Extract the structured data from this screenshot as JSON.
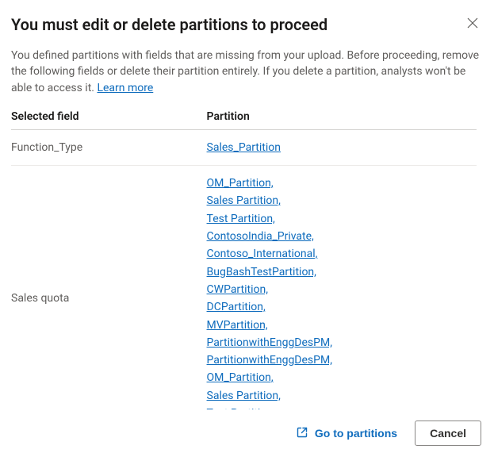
{
  "header": {
    "title": "You must edit or delete partitions to proceed"
  },
  "description": {
    "text": "You defined partitions with fields that are missing from your upload. Before proceeding, remove the following fields or delete their partition entirely. If you delete a partition, analysts won't be able to access it. ",
    "learn_more": "Learn more"
  },
  "table": {
    "col_field": "Selected field",
    "col_partition": "Partition",
    "rows": [
      {
        "field": "Function_Type",
        "partitions": [
          "Sales_Partition"
        ]
      },
      {
        "field": "Sales quota",
        "partitions": [
          "OM_Partition,",
          "Sales Partition,",
          "Test Partition,",
          "ContosoIndia_Private,",
          "Contoso_International,",
          "BugBashTestPartition,",
          "CWPartition,",
          "DCPartition,",
          "MVPartition,",
          "PartitionwithEnggDesPM,",
          "PartitionwithEnggDesPM,",
          "OM_Partition,",
          "Sales Partition,",
          "Test Partition"
        ]
      }
    ]
  },
  "footer": {
    "goto_label": "Go to partitions",
    "cancel_label": "Cancel"
  }
}
